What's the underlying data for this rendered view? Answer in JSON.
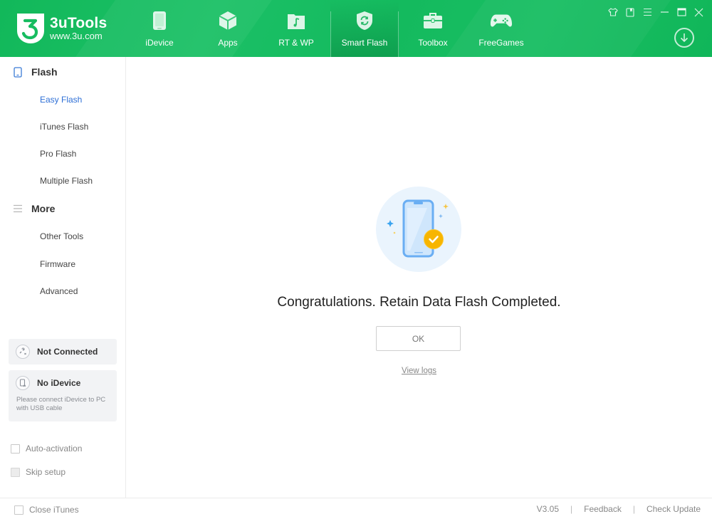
{
  "app": {
    "name": "3uTools",
    "url": "www.3u.com",
    "brand_color": "#17bc60"
  },
  "nav": {
    "items": [
      {
        "label": "iDevice",
        "icon": "phone-icon",
        "active": false
      },
      {
        "label": "Apps",
        "icon": "cube-icon",
        "active": false
      },
      {
        "label": "RT & WP",
        "icon": "music-folder-icon",
        "active": false
      },
      {
        "label": "Smart Flash",
        "icon": "shield-refresh-icon",
        "active": true
      },
      {
        "label": "Toolbox",
        "icon": "toolbox-icon",
        "active": false
      },
      {
        "label": "FreeGames",
        "icon": "gamepad-icon",
        "active": false
      }
    ]
  },
  "window_controls": [
    "skin-icon",
    "bookmark-icon",
    "menu-icon",
    "minimize-icon",
    "maximize-icon",
    "close-icon"
  ],
  "sidebar": {
    "sections": [
      {
        "label": "Flash",
        "icon": "tablet-icon",
        "items": [
          {
            "label": "Easy Flash",
            "active": true
          },
          {
            "label": "iTunes Flash",
            "active": false
          },
          {
            "label": "Pro Flash",
            "active": false
          },
          {
            "label": "Multiple Flash",
            "active": false
          }
        ]
      },
      {
        "label": "More",
        "icon": "list-icon",
        "items": [
          {
            "label": "Other Tools",
            "active": false
          },
          {
            "label": "Firmware",
            "active": false
          },
          {
            "label": "Advanced",
            "active": false
          }
        ]
      }
    ],
    "connection": {
      "title": "Not Connected"
    },
    "device": {
      "title": "No iDevice",
      "hint": "Please connect iDevice to PC with USB cable"
    },
    "options": [
      {
        "label": "Auto-activation",
        "checked": false,
        "disabled": false
      },
      {
        "label": "Skip setup",
        "checked": false,
        "disabled": true
      }
    ]
  },
  "main": {
    "message": "Congratulations. Retain Data Flash Completed.",
    "ok_label": "OK",
    "view_logs_label": "View logs"
  },
  "footer": {
    "close_itunes_label": "Close iTunes",
    "version": "V3.05",
    "separator": "|",
    "feedback_label": "Feedback",
    "check_update_label": "Check Update"
  }
}
